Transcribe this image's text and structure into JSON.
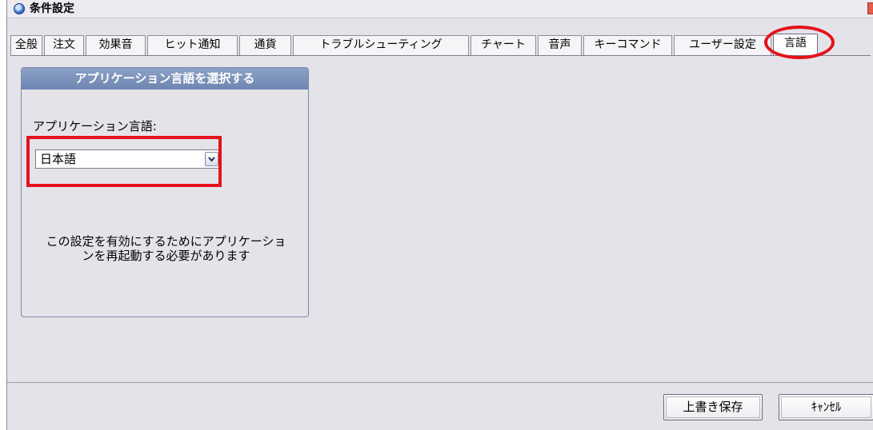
{
  "window": {
    "title": "条件設定",
    "app_icon": "app-globe-icon",
    "close_icon": "close-icon"
  },
  "tabs": [
    {
      "label": "全般",
      "active": false
    },
    {
      "label": "注文",
      "active": false
    },
    {
      "label": "効果音",
      "active": false
    },
    {
      "label": "ヒット通知",
      "active": false
    },
    {
      "label": "通貨",
      "active": false
    },
    {
      "label": "トラブルシューティング",
      "active": false
    },
    {
      "label": "チャート",
      "active": false
    },
    {
      "label": "音声",
      "active": false
    },
    {
      "label": "キーコマンド",
      "active": false
    },
    {
      "label": "ユーザー設定",
      "active": false
    },
    {
      "label": "言語",
      "active": true
    }
  ],
  "panel": {
    "header": "アプリケーション言語を選択する",
    "language_label": "アプリケーション言語:",
    "language_select": {
      "value": "日本語",
      "dropdown_icon": "chevron-down-icon"
    },
    "restart_note_line1": "この設定を有効にするためにアプリケーショ",
    "restart_note_line2": "ンを再起動する必要があります"
  },
  "footer": {
    "save_label": "上書き保存",
    "cancel_label": "ｷｬﾝｾﾙ"
  },
  "annotations": {
    "highlight_color": "#e4121b"
  }
}
